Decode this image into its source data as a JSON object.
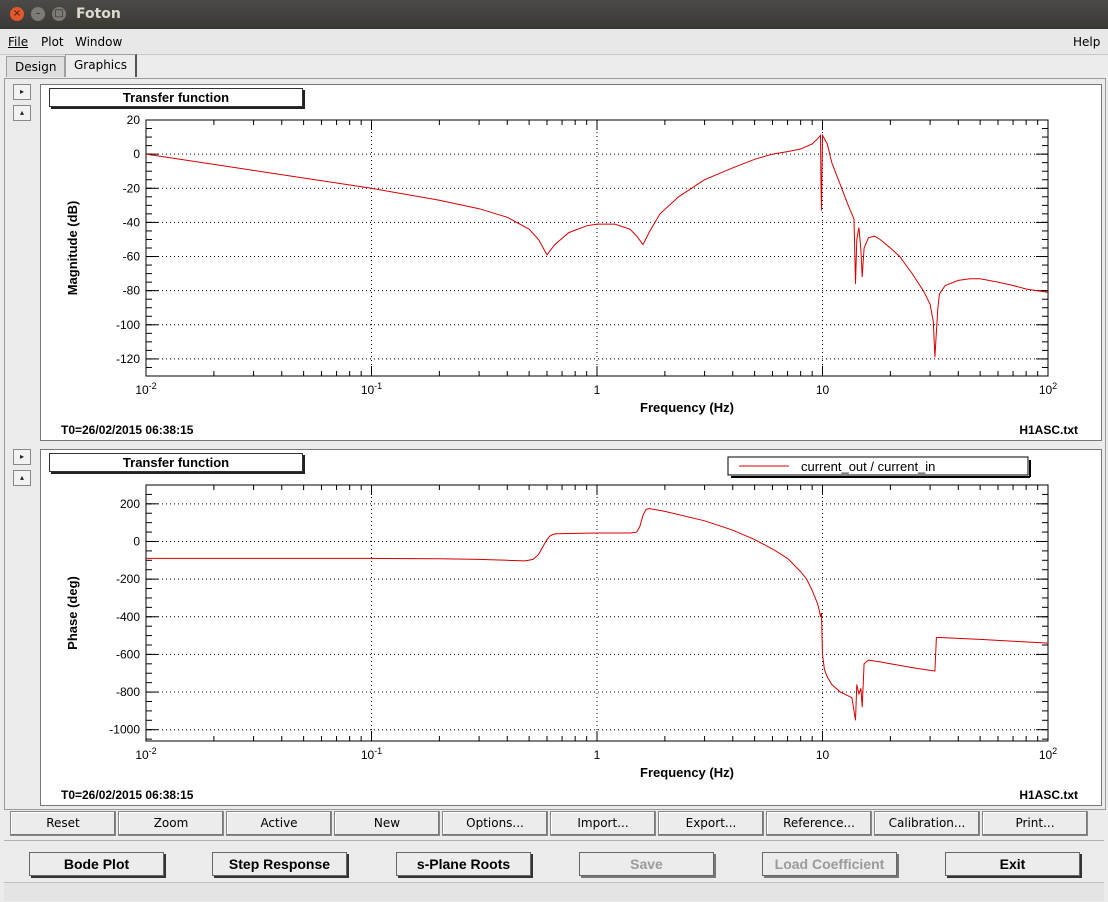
{
  "window": {
    "title": "Foton",
    "close_glyph": "×",
    "min_glyph": "–",
    "max_glyph": "□"
  },
  "menu": {
    "file": "File",
    "plot": "Plot",
    "window": "Window",
    "help": "Help"
  },
  "tabs": [
    {
      "label": "Design"
    },
    {
      "label": "Graphics"
    }
  ],
  "side_buttons": {
    "expand": "▸",
    "collapse": "▴"
  },
  "panels": [
    {
      "title": "Transfer function",
      "timestamp": "T0=26/02/2015 06:38:15",
      "filename": "H1ASC.txt"
    },
    {
      "title": "Transfer function",
      "timestamp": "T0=26/02/2015 06:38:15",
      "filename": "H1ASC.txt"
    }
  ],
  "chart_data": [
    {
      "type": "line",
      "xlabel": "Frequency (Hz)",
      "ylabel": "Magnitude (dB)",
      "xscale": "log",
      "xlim": [
        0.01,
        100
      ],
      "ylim": [
        -130,
        20
      ],
      "yticks": [
        20,
        0,
        -20,
        -40,
        -60,
        -80,
        -100,
        -120
      ],
      "xticks": [
        {
          "v": 0.01,
          "base": "10",
          "exp": "-2"
        },
        {
          "v": 0.1,
          "base": "10",
          "exp": "-1"
        },
        {
          "v": 1,
          "base": "1",
          "exp": ""
        },
        {
          "v": 10,
          "base": "10",
          "exp": ""
        },
        {
          "v": 100,
          "base": "10",
          "exp": "2"
        }
      ],
      "grid": true,
      "color": "#d40000",
      "series": [
        {
          "x": [
            0.01,
            0.02,
            0.05,
            0.1,
            0.2,
            0.3,
            0.4,
            0.5,
            0.55,
            0.6,
            0.65,
            0.75,
            0.9,
            1.0,
            1.2,
            1.4,
            1.5,
            1.6,
            1.7,
            1.9,
            2.3,
            3,
            4,
            5,
            6,
            7,
            8,
            9,
            9.5,
            9.8,
            9.85,
            9.9,
            10,
            10.5,
            11,
            12,
            13,
            13.5,
            13.8,
            14,
            14.2,
            14.5,
            14.8,
            15,
            15.3,
            16,
            17,
            18,
            20,
            22,
            25,
            28,
            30,
            31,
            31.5,
            32,
            32.5,
            33,
            35,
            40,
            45,
            50,
            60,
            70,
            80,
            90,
            100
          ],
          "y": [
            0,
            -6,
            -14,
            -20,
            -27,
            -32,
            -37,
            -44,
            -50,
            -59,
            -53,
            -46,
            -42,
            -41,
            -41,
            -44,
            -48,
            -53,
            -46,
            -35,
            -25,
            -15,
            -8,
            -3,
            0,
            1.5,
            3,
            6,
            9,
            11,
            -18,
            -33,
            11,
            6,
            -5,
            -18,
            -30,
            -35,
            -38,
            -76,
            -50,
            -43,
            -56,
            -72,
            -55,
            -49,
            -48,
            -50,
            -55,
            -60,
            -70,
            -80,
            -88,
            -98,
            -119,
            -104,
            -90,
            -82,
            -77,
            -74,
            -73,
            -73,
            -75,
            -77,
            -79,
            -80,
            -81
          ]
        }
      ]
    },
    {
      "type": "line",
      "xlabel": "Frequency (Hz)",
      "ylabel": "Phase (deg)",
      "xscale": "log",
      "xlim": [
        0.01,
        100
      ],
      "ylim": [
        -1060,
        300
      ],
      "yticks": [
        200,
        0,
        -200,
        -400,
        -600,
        -800,
        -1000
      ],
      "xticks": [
        {
          "v": 0.01,
          "base": "10",
          "exp": "-2"
        },
        {
          "v": 0.1,
          "base": "10",
          "exp": "-1"
        },
        {
          "v": 1,
          "base": "1",
          "exp": ""
        },
        {
          "v": 10,
          "base": "10",
          "exp": ""
        },
        {
          "v": 100,
          "base": "10",
          "exp": "2"
        }
      ],
      "grid": true,
      "legend": {
        "label": "current_out / current_in",
        "placement": "top-right"
      },
      "color": "#d40000",
      "series": [
        {
          "name": "current_out / current_in",
          "x": [
            0.01,
            0.05,
            0.1,
            0.2,
            0.3,
            0.4,
            0.48,
            0.52,
            0.55,
            0.58,
            0.6,
            0.62,
            0.65,
            0.7,
            1.0,
            1.4,
            1.5,
            1.55,
            1.6,
            1.65,
            1.7,
            1.8,
            2,
            3,
            4,
            5,
            6,
            7,
            8,
            8.5,
            9,
            9.5,
            9.7,
            9.8,
            9.9,
            10,
            10.2,
            10.5,
            11,
            12,
            13,
            13.5,
            13.8,
            14,
            14.2,
            14.5,
            14.8,
            15,
            15.3,
            16,
            18,
            20,
            25,
            30,
            31.5,
            32,
            32.5,
            33,
            40,
            50,
            70,
            100
          ],
          "y": [
            -90,
            -90,
            -90,
            -92,
            -95,
            -100,
            -103,
            -95,
            -70,
            -20,
            10,
            30,
            40,
            42,
            45,
            45,
            50,
            80,
            140,
            170,
            175,
            170,
            160,
            110,
            60,
            10,
            -40,
            -90,
            -160,
            -200,
            -260,
            -330,
            -370,
            -400,
            -380,
            -600,
            -680,
            -720,
            -760,
            -800,
            -820,
            -830,
            -900,
            -950,
            -760,
            -810,
            -780,
            -880,
            -650,
            -630,
            -640,
            -650,
            -670,
            -685,
            -688,
            -510,
            -510,
            -510,
            -515,
            -520,
            -530,
            -540
          ]
        }
      ]
    }
  ],
  "toolbar": [
    "Reset",
    "Zoom",
    "Active",
    "New",
    "Options...",
    "Import...",
    "Export...",
    "Reference...",
    "Calibration...",
    "Print..."
  ],
  "bottom_buttons": [
    {
      "label": "Bode Plot",
      "enabled": true
    },
    {
      "label": "Step Response",
      "enabled": true
    },
    {
      "label": "s-Plane Roots",
      "enabled": true
    },
    {
      "label": "Save",
      "enabled": false
    },
    {
      "label": "Load Coefficient",
      "enabled": false
    },
    {
      "label": "Exit",
      "enabled": true
    }
  ]
}
